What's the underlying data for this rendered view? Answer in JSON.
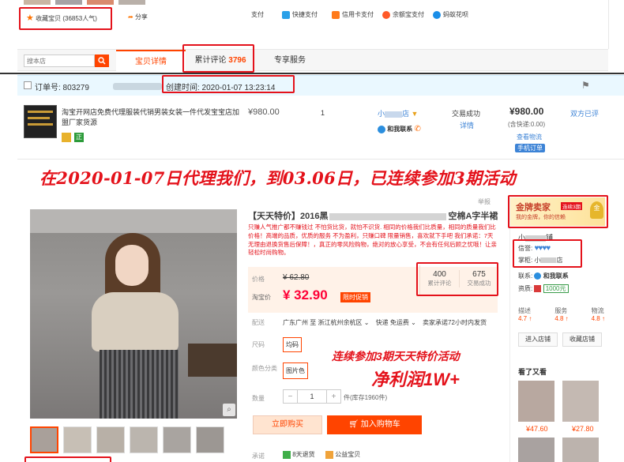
{
  "top": {
    "favorites": "收藏宝贝 (36853人气)",
    "share": "分享",
    "pay_label": "支付",
    "pay_methods": [
      "快捷支付",
      "信用卡支付",
      "余额宝支付",
      "蚂蚁花呗"
    ]
  },
  "tabs": {
    "search_placeholder": "搜本店",
    "items": [
      "宝贝详情",
      "累计评论",
      "专享服务"
    ],
    "review_count": "3796"
  },
  "order": {
    "order_no_label": "订单号: 803279",
    "created_time": "创建时间: 2020-01-07 13:23:14",
    "product_title": "淘宝开网店免费代理服装代销男装女装一件代发宝宝店加盟厂家货源",
    "price": "¥980.00",
    "quantity": "1",
    "seller": "小",
    "seller_suffix": "店",
    "wangwang": "和我联系",
    "status": "交易成功",
    "status_detail": "详情",
    "total": "¥980.00",
    "total_note": "(含快递:0.00)",
    "logistics": "查看物流",
    "mobile_order": "手机订单",
    "review": "双方已评",
    "badge": "正"
  },
  "banner": "在2020-01-07日代理我们，到03.06日，已连续参加3期活动",
  "product": {
    "report": "举报",
    "title_prefix": "【天天特价】2016黑",
    "title_suffix": "空棉A字半裙",
    "desc": "只赚人气推广都不赚钱过 不怕货比货，就怕不识货. 相同的价格我们比质量，相同的质量我们比价格！高端的品质，优质的服务 不为盈利，只赚口碑 限量销售，喜欢就下手吧 我们承诺：7天无理由退换货售后保障！，真正的零风险购物，绝对的放心享受，不会有任何后顾之忧哦！让亲轻松时尚购物。",
    "price_label": "价格",
    "orig_price": "¥ 62.80",
    "sale_label": "淘宝价",
    "sale_price": "¥ 32.90",
    "promo_tag": "限时促销",
    "reviews_num": "400",
    "reviews_label": "累计评论",
    "sold_num": "675",
    "sold_label": "交易成功",
    "ship_label": "配送",
    "ship_from": "广东广州 至",
    "ship_to": "浙江杭州余杭区",
    "express": "快递 免运费",
    "ship_promise": "卖家承诺72小时内发货",
    "size_label": "尺码",
    "size_val": "均码",
    "color_label": "颜色分类",
    "color_val": "图片色",
    "qty_label": "数量",
    "qty_minus": "−",
    "qty_val": "1",
    "qty_plus": "+",
    "stock": "件(库存1960件)",
    "buy_btn": "立即购买",
    "cart_btn": "加入购物车",
    "promise_label": "承诺",
    "promise1": "8天退货",
    "promise2": "公益宝贝"
  },
  "overlay": {
    "line1": "连续参加3期天天特价活动",
    "line2": "净利润1W+"
  },
  "shop": {
    "gold_title": "金牌卖家",
    "gold_tag": "连续3期",
    "gold_sub": "我的金牌，你的信赖",
    "name": "小",
    "name_suffix": "铺",
    "credit_label": "信誉:",
    "hearts": "♥♥♥♥",
    "keeper_label": "掌柜:",
    "keeper": "小",
    "keeper_suffix": "店",
    "contact_label": "联系:",
    "contact": "和我联系",
    "qual_label": "资质:",
    "deposit": "1000元",
    "scores": [
      {
        "label": "描述",
        "val": "4.7"
      },
      {
        "label": "服务",
        "val": "4.8"
      },
      {
        "label": "物流",
        "val": "4.8"
      }
    ],
    "enter_btn": "进入店铺",
    "fav_btn": "收藏店铺",
    "seen_label": "看了又看",
    "rec_prices": [
      "¥47.60",
      "¥27.80"
    ]
  },
  "colors": {
    "accent": "#ff4400",
    "red": "#e4121b",
    "price": "#ff0036",
    "blue": "#3c83d6"
  }
}
